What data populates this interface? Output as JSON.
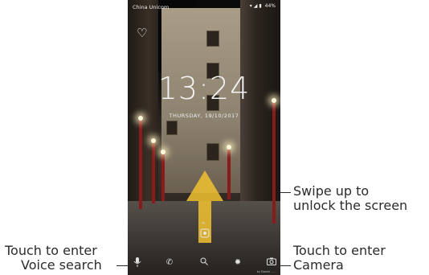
{
  "statusbar": {
    "carrier": "China Unicom",
    "battery": "44%"
  },
  "lockscreen": {
    "time": "13:24",
    "date": "THURSDAY, 19/10/2017",
    "photo_credit": "by Daniel ... ."
  },
  "icons": {
    "favorite": "heart-icon",
    "wifi": "wifi-icon",
    "signal": "signal-icon",
    "battery": "battery-icon",
    "mic": "microphone-icon",
    "phone": "phone-icon",
    "search": "search-icon",
    "settings": "gear-icon",
    "camera": "camera-icon"
  },
  "annotations": {
    "swipe_line1": "Swipe up to",
    "swipe_line2": "unlock the screen",
    "voice_line1": "Touch to enter",
    "voice_line2": "Voice search",
    "camera_line1": "Touch to enter",
    "camera_line2": "Camera"
  },
  "colors": {
    "arrow": "#f2c230",
    "text": "#2b2b2b"
  }
}
